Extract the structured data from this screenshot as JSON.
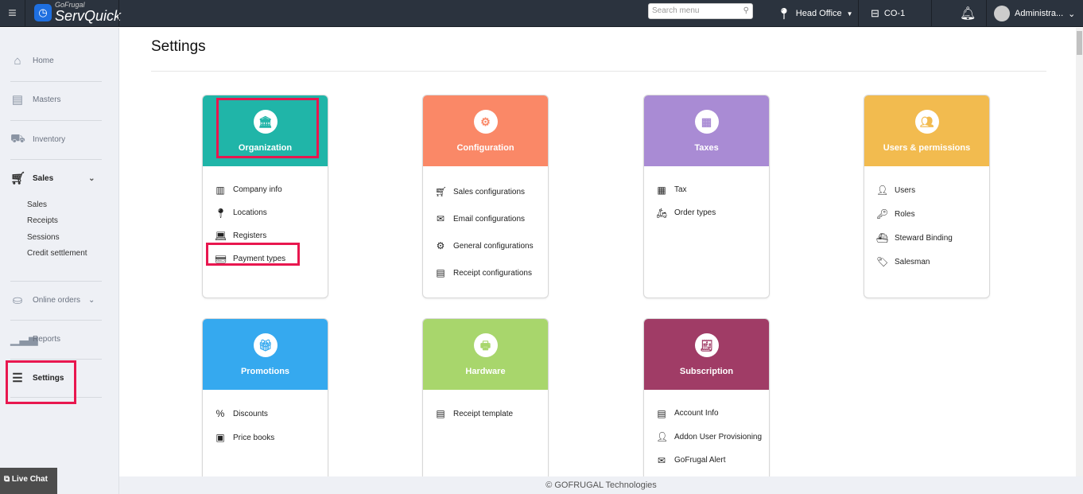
{
  "header": {
    "brand_top": "GoFrugal",
    "brand": "ServQuick",
    "search_placeholder": "Search menu",
    "location": "Head Office",
    "register": "CO-1",
    "user": "Administra..."
  },
  "sidebar": {
    "items": [
      {
        "label": "Home",
        "icon": "home-icon"
      },
      {
        "label": "Masters",
        "icon": "masters-icon"
      },
      {
        "label": "Inventory",
        "icon": "inventory-icon"
      },
      {
        "label": "Sales",
        "icon": "cart-icon"
      },
      {
        "label": "Online orders",
        "icon": "online-orders-icon"
      },
      {
        "label": "Reports",
        "icon": "reports-icon"
      },
      {
        "label": "Settings",
        "icon": "sliders-icon"
      }
    ],
    "sales_sub": [
      "Sales",
      "Receipts",
      "Sessions",
      "Credit settlement"
    ],
    "live_chat": "Live Chat"
  },
  "page": {
    "title": "Settings",
    "footer": "© GOFRUGAL Technologies"
  },
  "cards": [
    {
      "title": "Organization",
      "color": "#20b5a8",
      "items": [
        "Company info",
        "Locations",
        "Registers",
        "Payment types"
      ]
    },
    {
      "title": "Configuration",
      "color": "#fa8867",
      "items": [
        "Sales configurations",
        "Email configurations",
        "General configurations",
        "Receipt configurations"
      ]
    },
    {
      "title": "Taxes",
      "color": "#a98bd4",
      "items": [
        "Tax",
        "Order types"
      ]
    },
    {
      "title": "Users & permissions",
      "color": "#f2bb4f",
      "items": [
        "Users",
        "Roles",
        "Steward Binding",
        "Salesman"
      ]
    },
    {
      "title": "Promotions",
      "color": "#35a9ef",
      "items": [
        "Discounts",
        "Price books"
      ]
    },
    {
      "title": "Hardware",
      "color": "#a8d66c",
      "items": [
        "Receipt template"
      ]
    },
    {
      "title": "Subscription",
      "color": "#a03c66",
      "items": [
        "Account Info",
        "Addon User Provisioning",
        "GoFrugal Alert"
      ]
    }
  ]
}
